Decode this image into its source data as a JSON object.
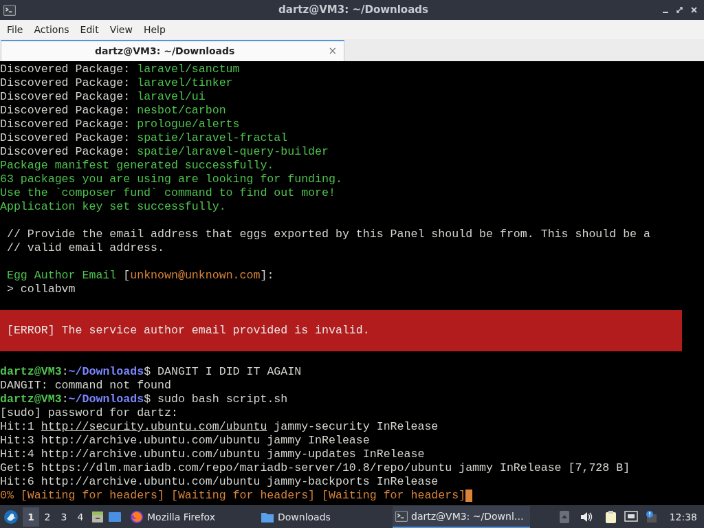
{
  "window": {
    "title": "dartz@VM3: ~/Downloads"
  },
  "menu": [
    "File",
    "Actions",
    "Edit",
    "View",
    "Help"
  ],
  "tabs": [
    {
      "label": "dartz@VM3: ~/Downloads",
      "selected": true,
      "close": "×"
    }
  ],
  "terminal": {
    "lines": [
      {
        "kind": "text",
        "segments": [
          {
            "kind": "plain",
            "text": "Discovered Package: "
          },
          {
            "kind": "green",
            "text": "laravel/sanctum"
          }
        ]
      },
      {
        "kind": "text",
        "segments": [
          {
            "kind": "plain",
            "text": "Discovered Package: "
          },
          {
            "kind": "green",
            "text": "laravel/tinker"
          }
        ]
      },
      {
        "kind": "text",
        "segments": [
          {
            "kind": "plain",
            "text": "Discovered Package: "
          },
          {
            "kind": "green",
            "text": "laravel/ui"
          }
        ]
      },
      {
        "kind": "text",
        "segments": [
          {
            "kind": "plain",
            "text": "Discovered Package: "
          },
          {
            "kind": "green",
            "text": "nesbot/carbon"
          }
        ]
      },
      {
        "kind": "text",
        "segments": [
          {
            "kind": "plain",
            "text": "Discovered Package: "
          },
          {
            "kind": "green",
            "text": "prologue/alerts"
          }
        ]
      },
      {
        "kind": "text",
        "segments": [
          {
            "kind": "plain",
            "text": "Discovered Package: "
          },
          {
            "kind": "green",
            "text": "spatie/laravel-fractal"
          }
        ]
      },
      {
        "kind": "text",
        "segments": [
          {
            "kind": "plain",
            "text": "Discovered Package: "
          },
          {
            "kind": "green",
            "text": "spatie/laravel-query-builder"
          }
        ]
      },
      {
        "kind": "text",
        "segments": [
          {
            "kind": "green",
            "text": "Package manifest generated successfully."
          }
        ]
      },
      {
        "kind": "text",
        "segments": [
          {
            "kind": "green",
            "text": "63 packages you are using are looking for funding."
          }
        ]
      },
      {
        "kind": "text",
        "segments": [
          {
            "kind": "green",
            "text": "Use the `composer fund` command to find out more!"
          }
        ]
      },
      {
        "kind": "text",
        "segments": [
          {
            "kind": "green",
            "text": "Application key set successfully."
          }
        ]
      },
      {
        "kind": "blank"
      },
      {
        "kind": "text",
        "segments": [
          {
            "kind": "plain",
            "text": " // Provide the email address that eggs exported by this Panel should be from. This should be a"
          }
        ]
      },
      {
        "kind": "text",
        "segments": [
          {
            "kind": "plain",
            "text": " // valid email address."
          }
        ]
      },
      {
        "kind": "blank"
      },
      {
        "kind": "text",
        "segments": [
          {
            "kind": "green",
            "text": " Egg Author Email "
          },
          {
            "kind": "plain",
            "text": "["
          },
          {
            "kind": "orange",
            "text": "unknown@unknown.com"
          },
          {
            "kind": "plain",
            "text": "]:"
          }
        ]
      },
      {
        "kind": "text",
        "segments": [
          {
            "kind": "plain",
            "text": " > collabvm"
          }
        ]
      },
      {
        "kind": "blank"
      },
      {
        "kind": "error",
        "text": " [ERROR] The service author email provided is invalid."
      },
      {
        "kind": "blank"
      },
      {
        "kind": "text",
        "segments": [
          {
            "kind": "user",
            "text": "dartz@VM3"
          },
          {
            "kind": "plain",
            "text": ":"
          },
          {
            "kind": "path",
            "text": "~/Downloads"
          },
          {
            "kind": "plain",
            "text": "$ DANGIT I DID IT AGAIN"
          }
        ]
      },
      {
        "kind": "text",
        "segments": [
          {
            "kind": "plain",
            "text": "DANGIT: command not found"
          }
        ]
      },
      {
        "kind": "text",
        "segments": [
          {
            "kind": "user",
            "text": "dartz@VM3"
          },
          {
            "kind": "plain",
            "text": ":"
          },
          {
            "kind": "path",
            "text": "~/Downloads"
          },
          {
            "kind": "plain",
            "text": "$ sudo bash script.sh"
          }
        ]
      },
      {
        "kind": "text",
        "segments": [
          {
            "kind": "plain",
            "text": "[sudo] password for dartz:"
          }
        ]
      },
      {
        "kind": "text",
        "segments": [
          {
            "kind": "plain",
            "text": "Hit:1 "
          },
          {
            "kind": "link",
            "text": "http://security.ubuntu.com/ubuntu"
          },
          {
            "kind": "plain",
            "text": " jammy-security InRelease"
          }
        ]
      },
      {
        "kind": "text",
        "segments": [
          {
            "kind": "plain",
            "text": "Hit:3 http://archive.ubuntu.com/ubuntu jammy InRelease"
          }
        ]
      },
      {
        "kind": "text",
        "segments": [
          {
            "kind": "plain",
            "text": "Hit:4 http://archive.ubuntu.com/ubuntu jammy-updates InRelease"
          }
        ]
      },
      {
        "kind": "text",
        "segments": [
          {
            "kind": "plain",
            "text": "Get:5 https://dlm.mariadb.com/repo/mariadb-server/10.8/repo/ubuntu jammy InRelease [7,728 B]"
          }
        ]
      },
      {
        "kind": "text",
        "segments": [
          {
            "kind": "plain",
            "text": "Hit:6 http://archive.ubuntu.com/ubuntu jammy-backports InRelease"
          }
        ]
      },
      {
        "kind": "text",
        "cursor": true,
        "segments": [
          {
            "kind": "orange",
            "text": "0% [Waiting for headers] [Waiting for headers] [Waiting for headers]"
          }
        ]
      }
    ]
  },
  "taskbar": {
    "workspaces": [
      {
        "label": "1",
        "selected": true
      },
      {
        "label": "2",
        "selected": false
      },
      {
        "label": "3",
        "selected": false
      },
      {
        "label": "4",
        "selected": false
      }
    ],
    "tasks": [
      {
        "kind": "browser",
        "label": "Mozilla Firefox",
        "selected": false
      },
      {
        "kind": "folder",
        "label": "Downloads",
        "selected": false
      },
      {
        "kind": "terminal",
        "label": "dartz@VM3: ~/Downl…",
        "selected": true
      }
    ],
    "clock": "12:38"
  }
}
